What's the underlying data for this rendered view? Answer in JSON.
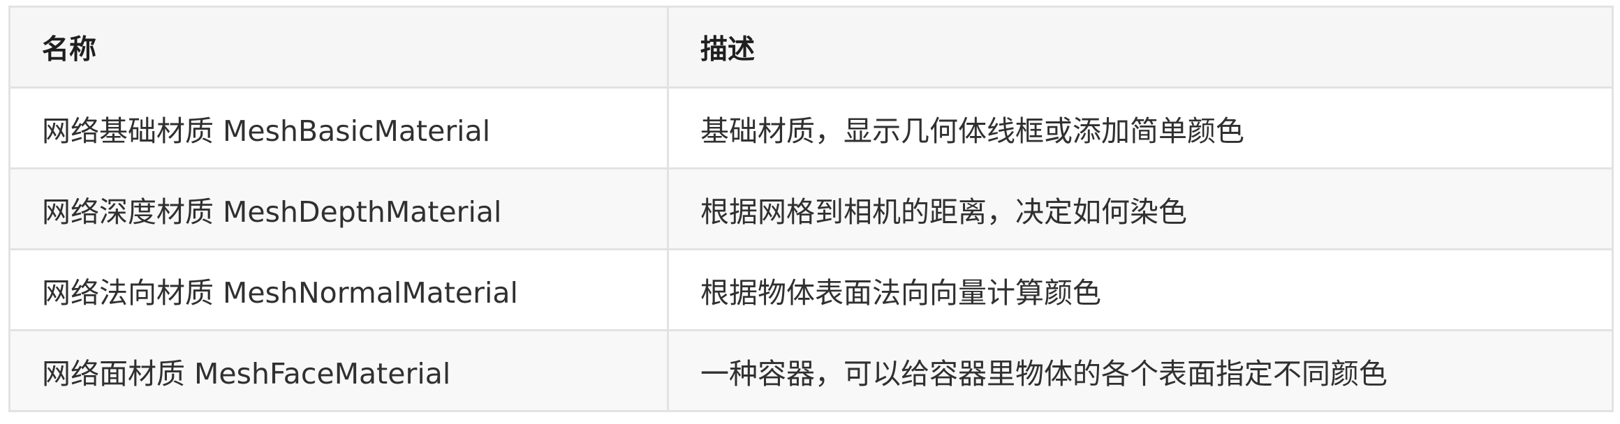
{
  "table": {
    "headers": [
      "名称",
      "描述"
    ],
    "rows": [
      {
        "name": "网络基础材质 MeshBasicMaterial",
        "description": "基础材质，显示几何体线框或添加简单颜色"
      },
      {
        "name": "网络深度材质 MeshDepthMaterial",
        "description": "根据网格到相机的距离，决定如何染色"
      },
      {
        "name": "网络法向材质 MeshNormalMaterial",
        "description": "根据物体表面法向向量计算颜色"
      },
      {
        "name": "网络面材质 MeshFaceMaterial",
        "description": "一种容器，可以给容器里物体的各个表面指定不同颜色"
      }
    ]
  }
}
